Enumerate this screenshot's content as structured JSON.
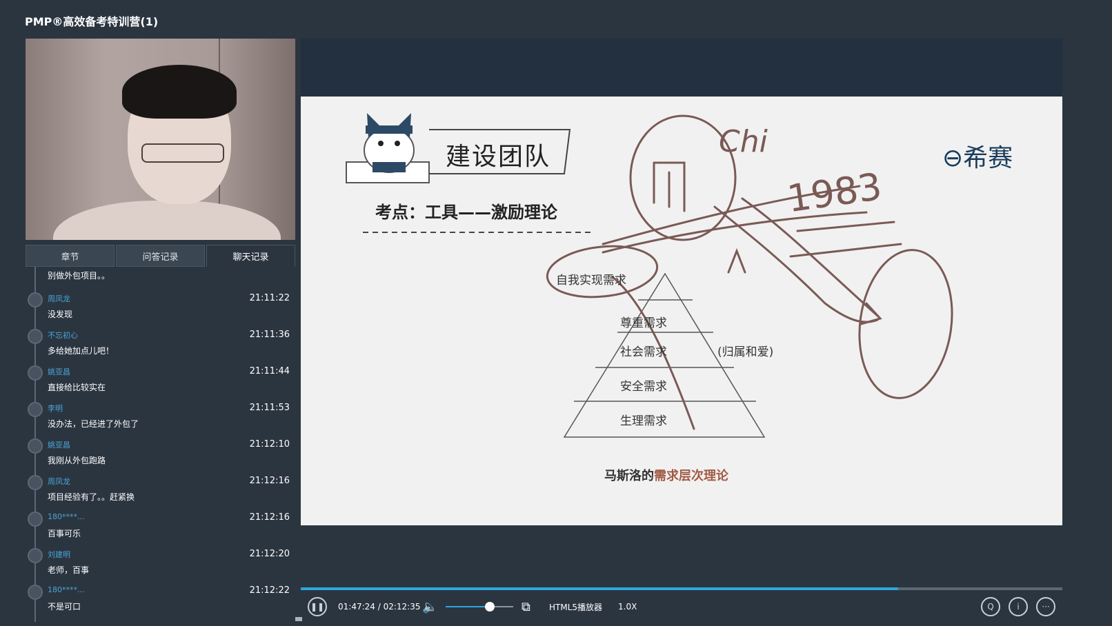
{
  "app": {
    "title": "PMP®高效备考特训营(1)"
  },
  "sidebar": {
    "tabs": [
      "章节",
      "问答记录",
      "聊天记录"
    ],
    "first_text": "别做外包项目。。",
    "messages": [
      {
        "name": "周凤龙",
        "time": "21:11:22",
        "text": "没发现"
      },
      {
        "name": "不忘初心",
        "time": "21:11:36",
        "text": "多给她加点儿吧！"
      },
      {
        "name": "姚亚昌",
        "time": "21:11:44",
        "text": "直接给比较实在"
      },
      {
        "name": "李明",
        "time": "21:11:53",
        "text": "没办法，已经进了外包了"
      },
      {
        "name": "姚亚昌",
        "time": "21:12:10",
        "text": "我刚从外包跑路"
      },
      {
        "name": "周凤龙",
        "time": "21:12:16",
        "text": "项目经验有了。。赶紧换"
      },
      {
        "name": "180****...",
        "time": "21:12:16",
        "text": "百事可乐"
      },
      {
        "name": "刘建明",
        "time": "21:12:20",
        "text": "老师，百事"
      },
      {
        "name": "180****...",
        "time": "21:12:22",
        "text": "不是可口"
      }
    ]
  },
  "slide": {
    "title": "建设团队",
    "subtitle": "考点：工具——激励理论",
    "brand": "希赛",
    "pyramid": [
      "自我实现需求",
      "尊重需求",
      "社会需求",
      "安全需求",
      "生理需求"
    ],
    "social_note": "(归属和爱)",
    "caption_prefix": "马斯洛的",
    "caption_highlight": "需求层次理论",
    "handwriting": {
      "word": "Chi",
      "year": "1983"
    }
  },
  "player": {
    "time": "01:47:24 / 02:12:35",
    "progress": 0.784,
    "volume": 0.65,
    "mode": "HTML5播放器",
    "speed": "1.0X"
  },
  "colors": {
    "accent": "#2ba7e0",
    "background": "#2b3540",
    "slide": "#f1f1f1"
  },
  "icons": [
    "pause-icon",
    "volume-icon",
    "picture-in-picture-icon",
    "qa-icon",
    "info-icon",
    "more-icon"
  ]
}
